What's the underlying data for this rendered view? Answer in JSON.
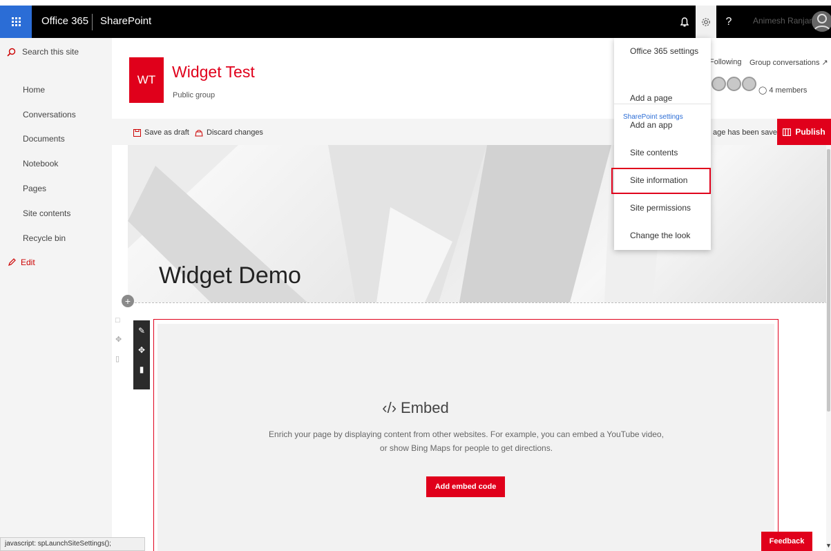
{
  "colors": {
    "accent": "#e0001b",
    "suitebar": "#000000",
    "waffle": "#2b6dd6",
    "link": "#2b6dd6"
  },
  "suitebar": {
    "brand": "Office 365",
    "app": "SharePoint",
    "user_name": "Animesh Ranjan",
    "icons": [
      "app-launcher-icon",
      "bell-icon",
      "gear-icon",
      "help-icon",
      "user-avatar"
    ]
  },
  "leftnav": {
    "search_placeholder": "Search this site",
    "items": [
      {
        "label": "Home"
      },
      {
        "label": "Conversations"
      },
      {
        "label": "Documents"
      },
      {
        "label": "Notebook"
      },
      {
        "label": "Pages"
      },
      {
        "label": "Site contents"
      },
      {
        "label": "Recycle bin"
      }
    ],
    "edit_label": "Edit"
  },
  "site": {
    "logo_initials": "WT",
    "title": "Widget Test",
    "subtitle": "Public group",
    "following": "Following",
    "group_conversations": "Group conversations ↗",
    "members": "4 members"
  },
  "commandbar": {
    "save_draft": "Save as draft",
    "discard": "Discard changes",
    "saved_status": "age has been saved",
    "publish": "Publish"
  },
  "hero": {
    "title": "Widget Demo"
  },
  "embed": {
    "title": "Embed",
    "description_line1": "Enrich your page by displaying content from other websites. For example, you can embed a YouTube video,",
    "description_line2": "or show Bing Maps for people to get directions.",
    "button": "Add embed code"
  },
  "settings_menu": {
    "office_settings": "Office 365 settings",
    "heading": "SharePoint settings",
    "items": [
      {
        "label": "Add a page"
      },
      {
        "label": "Add an app"
      },
      {
        "label": "Site contents"
      },
      {
        "label": "Site information"
      },
      {
        "label": "Site permissions"
      },
      {
        "label": "Change the look"
      }
    ],
    "highlighted": "Site information"
  },
  "statusbar": {
    "text": "javascript: spLaunchSiteSettings();"
  },
  "feedback": "Feedback"
}
